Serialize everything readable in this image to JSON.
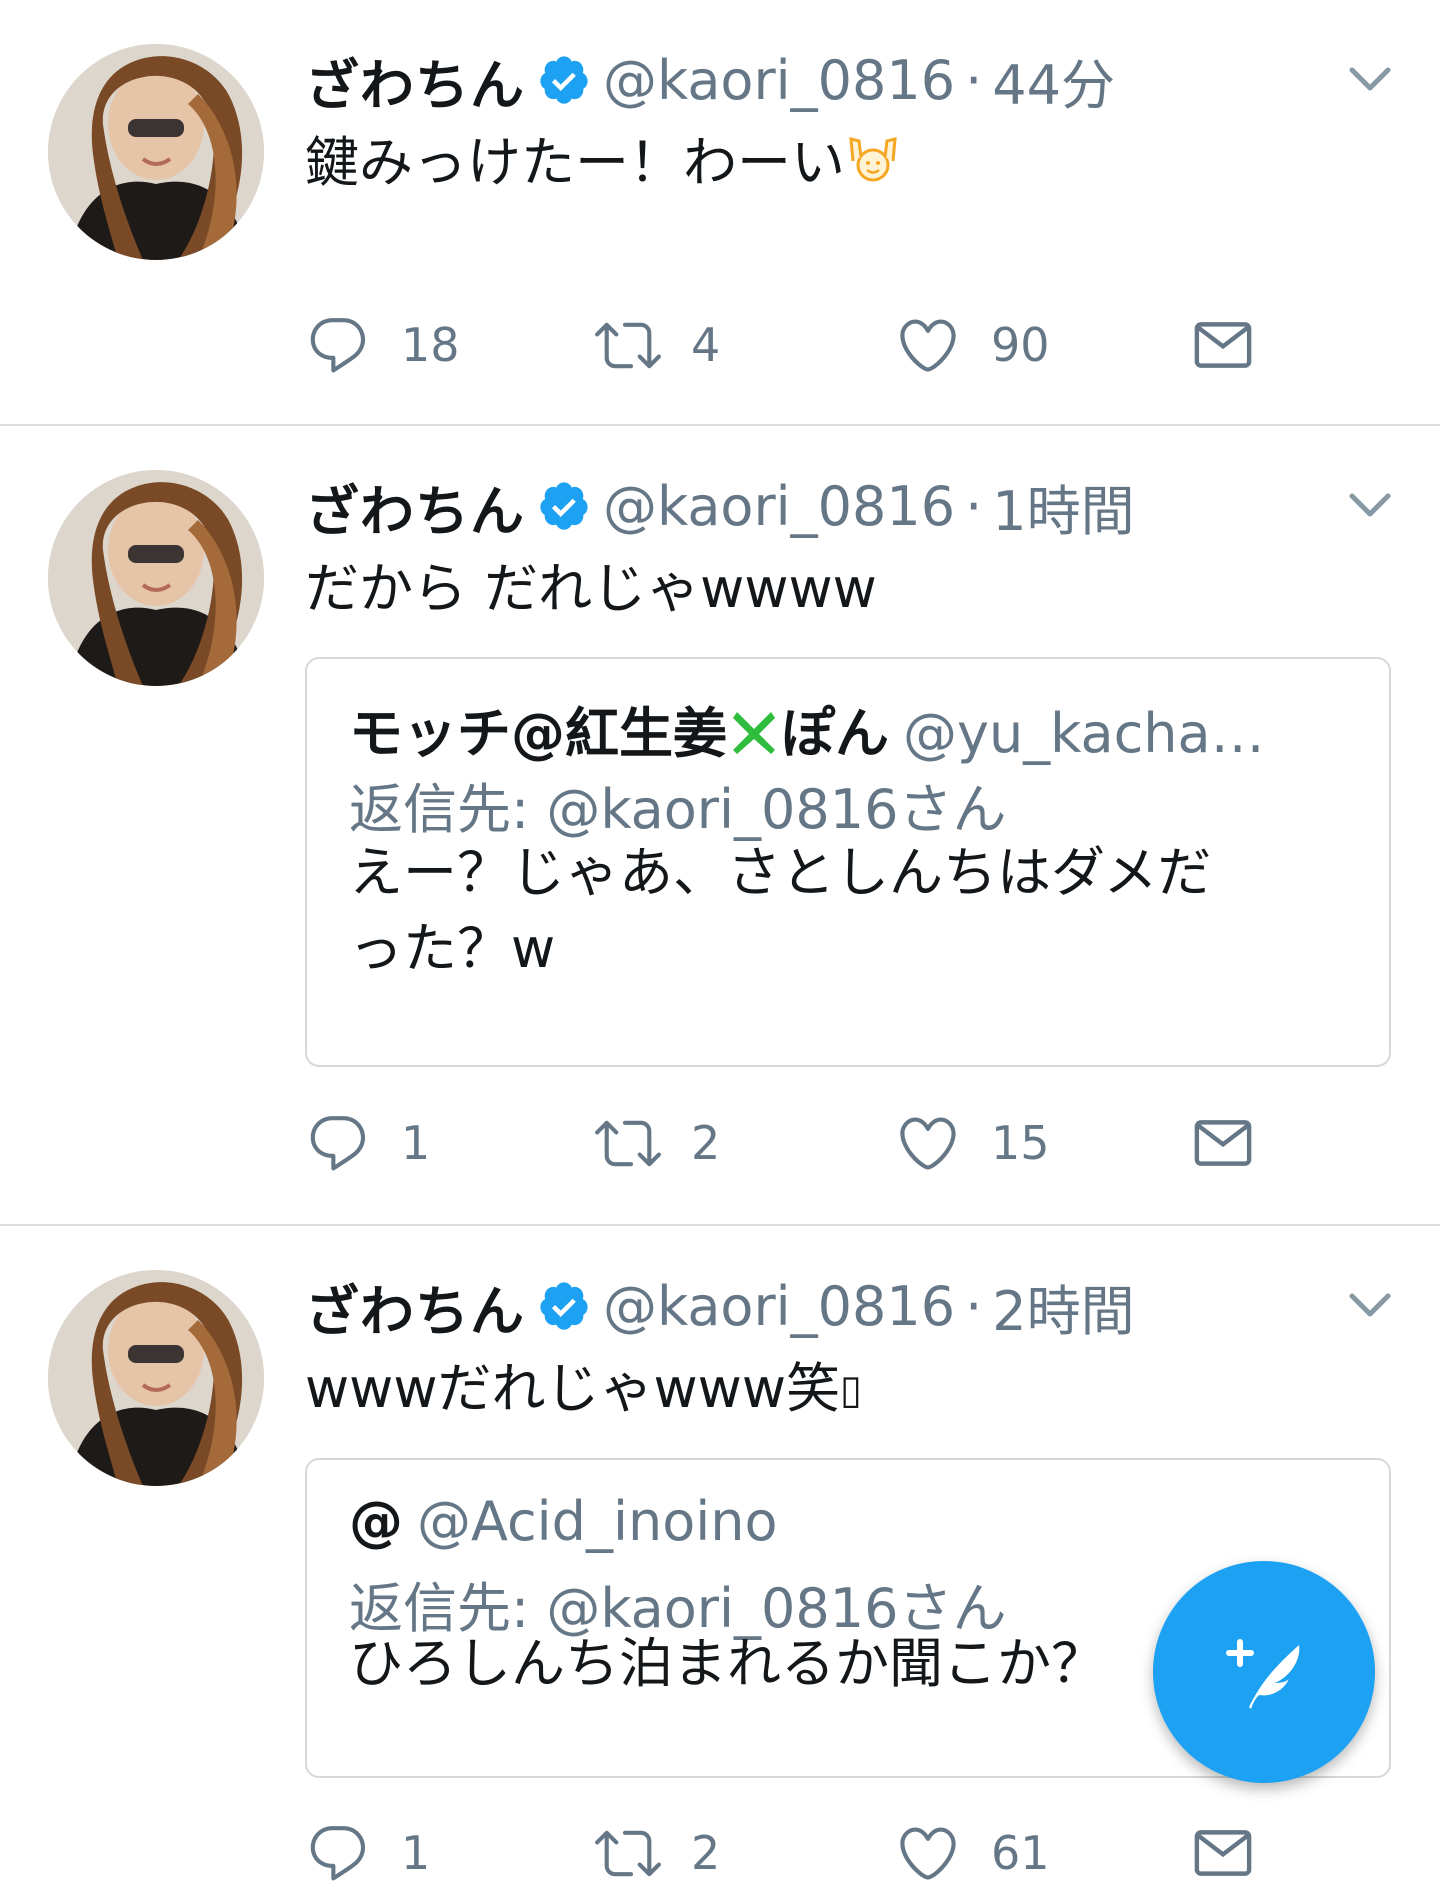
{
  "tweets": [
    {
      "name": "ざわちん",
      "handle": "@kaori_0816",
      "separator": "·",
      "time": "44分",
      "text": "鍵みっけたー！わーい",
      "text_emoji": "raising-hands-emoji",
      "actions": {
        "replies": "18",
        "retweets": "4",
        "likes": "90"
      }
    },
    {
      "name": "ざわちん",
      "handle": "@kaori_0816",
      "separator": "·",
      "time": "1時間",
      "text": "だから だれじゃwwww",
      "quote": {
        "name_prefix": "モッチ@紅生姜",
        "name_suffix": "ぽん",
        "handle": "@yu_kacha…",
        "reply_to": "返信先: @kaori_0816さん",
        "text_line1": "えー？じゃあ、さとしんちはダメだ",
        "text_line2": "った？w"
      },
      "actions": {
        "replies": "1",
        "retweets": "2",
        "likes": "15"
      }
    },
    {
      "name": "ざわちん",
      "handle": "@kaori_0816",
      "separator": "·",
      "time": "2時間",
      "text": "wwwだれじゃwww笑",
      "text_tail": "▯",
      "quote": {
        "name": "@",
        "handle": "@Acid_inoino",
        "reply_to": "返信先: @kaori_0816さん",
        "text_line1": "ひろしんち泊まれるか聞こか？"
      },
      "actions": {
        "replies": "1",
        "retweets": "2",
        "likes": "61"
      }
    }
  ],
  "colors": {
    "accent": "#1da1f2",
    "secondary_text": "#657786",
    "primary_text": "#14171a",
    "divider": "#dcdfe2",
    "cross_mark": "#2ebd3c",
    "emoji_orange": "#f5a623"
  },
  "icons": {
    "reply": "reply-icon",
    "retweet": "retweet-icon",
    "like": "heart-icon",
    "dm": "envelope-icon",
    "verified": "verified-badge-icon",
    "more": "chevron-down-icon",
    "compose": "compose-tweet-icon"
  }
}
